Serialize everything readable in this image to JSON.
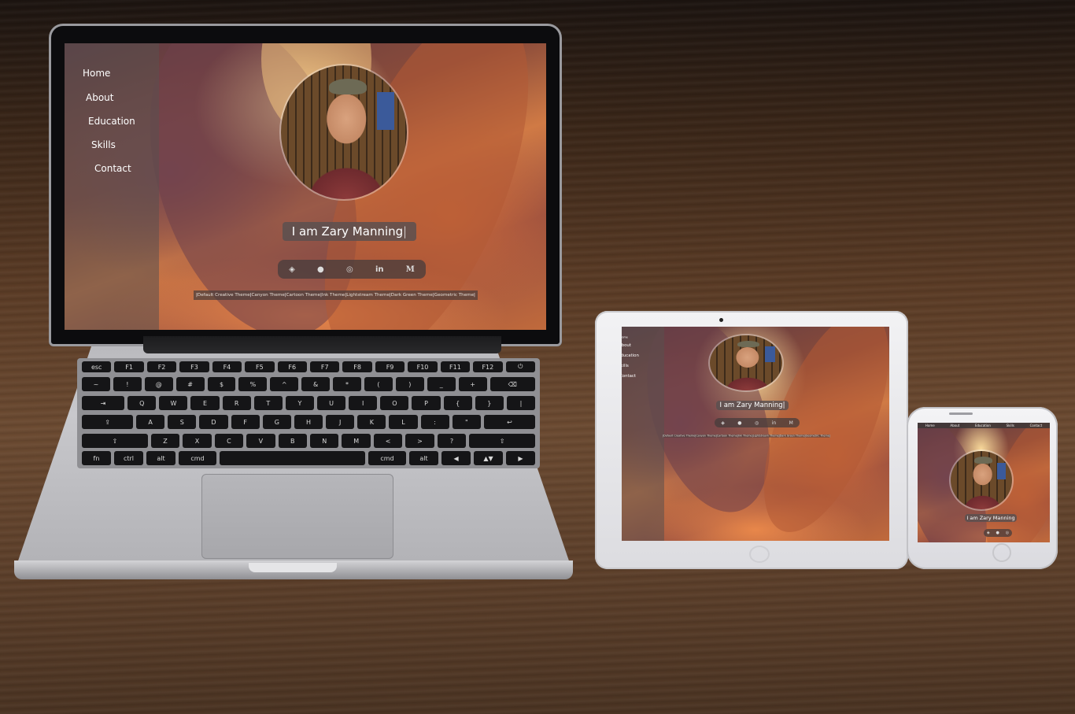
{
  "site": {
    "nav": [
      "Home",
      "About",
      "Education",
      "Skills",
      "Contact"
    ],
    "headline": "I am Zary Manning",
    "cursor": "|",
    "social_icons": [
      "codepen-icon",
      "github-icon",
      "instagram-icon",
      "linkedin-icon",
      "medium-icon"
    ],
    "social_glyphs": [
      "◈",
      "●",
      "◎",
      "in",
      "M"
    ],
    "themes": [
      "Default Creative Theme",
      "Canyon Theme",
      "Cartoon Theme",
      "Ink Theme",
      "Lightstream Theme",
      "Dark Green Theme",
      "Geometric Theme"
    ],
    "theme_separator": "|"
  },
  "keyboard": {
    "rows": [
      [
        "esc",
        "F1",
        "F2",
        "F3",
        "F4",
        "F5",
        "F6",
        "F7",
        "F8",
        "F9",
        "F10",
        "F11",
        "F12",
        "⏻"
      ],
      [
        "~",
        "!",
        "@",
        "#",
        "$",
        "%",
        "^",
        "&",
        "*",
        "(",
        ")",
        "_",
        "+",
        "⌫"
      ],
      [
        "⇥",
        "Q",
        "W",
        "E",
        "R",
        "T",
        "Y",
        "U",
        "I",
        "O",
        "P",
        "{",
        "}",
        "|"
      ],
      [
        "⇪",
        "A",
        "S",
        "D",
        "F",
        "G",
        "H",
        "J",
        "K",
        "L",
        ":",
        "\"",
        "↩"
      ],
      [
        "⇧",
        "Z",
        "X",
        "C",
        "V",
        "B",
        "N",
        "M",
        "<",
        ">",
        "?",
        "⇧"
      ],
      [
        "fn",
        "ctrl",
        "alt",
        "cmd",
        "",
        "cmd",
        "alt",
        "◀",
        "▲▼",
        "▶"
      ]
    ]
  },
  "colors": {
    "nav_overlay": "#5a504e",
    "name_box": "#5a5050",
    "wood_dark": "#3a2618",
    "wood_light": "#6b4a31"
  }
}
